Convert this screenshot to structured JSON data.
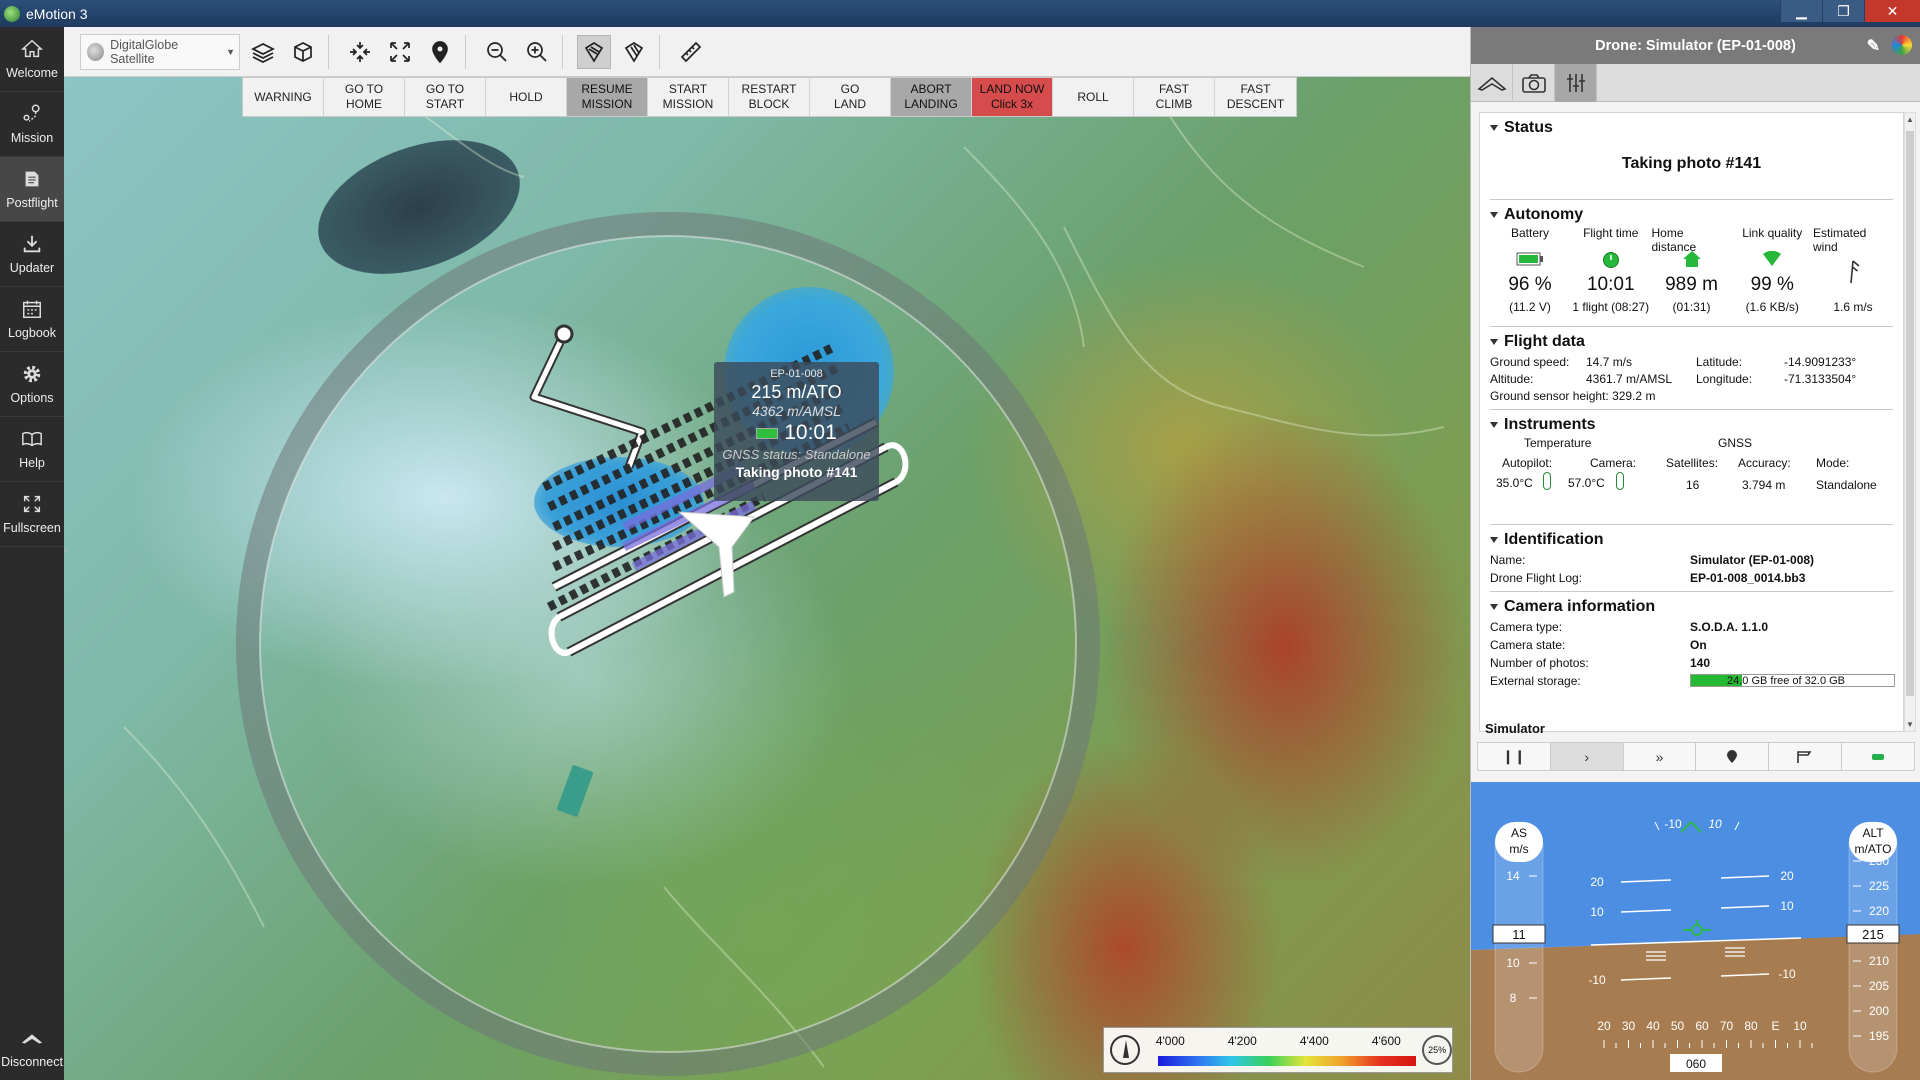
{
  "window": {
    "title": "eMotion 3"
  },
  "sidebar": {
    "items": [
      {
        "label": "Welcome",
        "icon": "home-icon"
      },
      {
        "label": "Mission",
        "icon": "mission-icon"
      },
      {
        "label": "Postflight",
        "icon": "postflight-icon"
      },
      {
        "label": "Updater",
        "icon": "download-icon"
      },
      {
        "label": "Logbook",
        "icon": "calendar-icon"
      },
      {
        "label": "Options",
        "icon": "gear-icon"
      },
      {
        "label": "Help",
        "icon": "book-icon"
      },
      {
        "label": "Fullscreen",
        "icon": "fullscreen-icon"
      }
    ],
    "disconnect": "Disconnect"
  },
  "toolbar": {
    "map_source": "DigitalGlobe Satellite"
  },
  "commands": [
    {
      "label": "WARNING",
      "style": ""
    },
    {
      "label": "GO TO\nHOME",
      "style": ""
    },
    {
      "label": "GO TO\nSTART",
      "style": ""
    },
    {
      "label": "HOLD",
      "style": ""
    },
    {
      "label": "RESUME\nMISSION",
      "style": "gray"
    },
    {
      "label": "START\nMISSION",
      "style": ""
    },
    {
      "label": "RESTART\nBLOCK",
      "style": ""
    },
    {
      "label": "GO\nLAND",
      "style": ""
    },
    {
      "label": "ABORT\nLANDING",
      "style": "gray"
    },
    {
      "label": "LAND NOW\nClick 3x",
      "style": "red"
    },
    {
      "label": "ROLL",
      "style": ""
    },
    {
      "label": "FAST\nCLIMB",
      "style": ""
    },
    {
      "label": "FAST\nDESCENT",
      "style": ""
    }
  ],
  "drone_tip": {
    "id": "EP-01-008",
    "height_ato": "215 m/ATO",
    "height_amsl": "4362 m/AMSL",
    "time": "10:01",
    "gnss": "GNSS status: Standalone",
    "status": "Taking photo #141"
  },
  "legend": {
    "ticks": [
      "4'000",
      "4'200",
      "4'400",
      "4'600"
    ],
    "zoom": "25%"
  },
  "panel": {
    "title": "Drone: Simulator (EP-01-008)",
    "status": {
      "heading": "Status",
      "value": "Taking photo #141"
    },
    "autonomy": {
      "heading": "Autonomy",
      "cols": [
        {
          "label": "Battery",
          "value": "96 %",
          "sub": "(11.2 V)"
        },
        {
          "label": "Flight time",
          "value": "10:01",
          "sub": "1 flight (08:27)"
        },
        {
          "label": "Home distance",
          "value": "989 m",
          "sub": "(01:31)"
        },
        {
          "label": "Link quality",
          "value": "99 %",
          "sub": "(1.6 KB/s)"
        },
        {
          "label": "Estimated wind",
          "value": "",
          "sub": "1.6 m/s"
        }
      ]
    },
    "flight_data": {
      "heading": "Flight data",
      "ground_speed_label": "Ground speed:",
      "ground_speed": "14.7 m/s",
      "latitude_label": "Latitude:",
      "latitude": "-14.9091233°",
      "altitude_label": "Altitude:",
      "altitude": "4361.7 m/AMSL",
      "longitude_label": "Longitude:",
      "longitude": "-71.3133504°",
      "ground_sensor": "Ground sensor height: 329.2 m"
    },
    "instruments": {
      "heading": "Instruments",
      "temperature": "Temperature",
      "gnss": "GNSS",
      "autopilot_label": "Autopilot:",
      "autopilot": "35.0°C",
      "camera_label": "Camera:",
      "camera": "57.0°C",
      "satellites_label": "Satellites:",
      "satellites": "16",
      "accuracy_label": "Accuracy:",
      "accuracy": "3.794 m",
      "mode_label": "Mode:",
      "mode": "Standalone"
    },
    "identification": {
      "heading": "Identification",
      "name_label": "Name:",
      "name": "Simulator (EP-01-008)",
      "log_label": "Drone Flight Log:",
      "log": "EP-01-008_0014.bb3"
    },
    "camera": {
      "heading": "Camera information",
      "type_label": "Camera type:",
      "type": "S.O.D.A. 1.1.0",
      "state_label": "Camera state:",
      "state": "On",
      "photos_label": "Number of photos:",
      "photos": "140",
      "storage_label": "External storage:",
      "storage": "24.0 GB free of 32.0 GB",
      "storage_fraction": 0.25
    },
    "simulator": {
      "title": "Simulator"
    }
  },
  "hud": {
    "as_label": "AS\nm/s",
    "alt_label": "ALT\nm/ATO",
    "speed": "11",
    "altitude": "215",
    "heading": "060",
    "speed_ticks": [
      "14",
      "10",
      "8"
    ],
    "alt_ticks": [
      "230",
      "225",
      "220",
      "210",
      "205",
      "200",
      "195"
    ],
    "pitch_left": [
      "20",
      "10",
      "-10"
    ],
    "pitch_right": [
      "20",
      "10",
      "-10"
    ],
    "roll_labels": [
      "-10",
      "10"
    ],
    "heading_ticks": [
      "20",
      "30",
      "40",
      "50",
      "60",
      "70",
      "80",
      "E",
      "10"
    ]
  }
}
